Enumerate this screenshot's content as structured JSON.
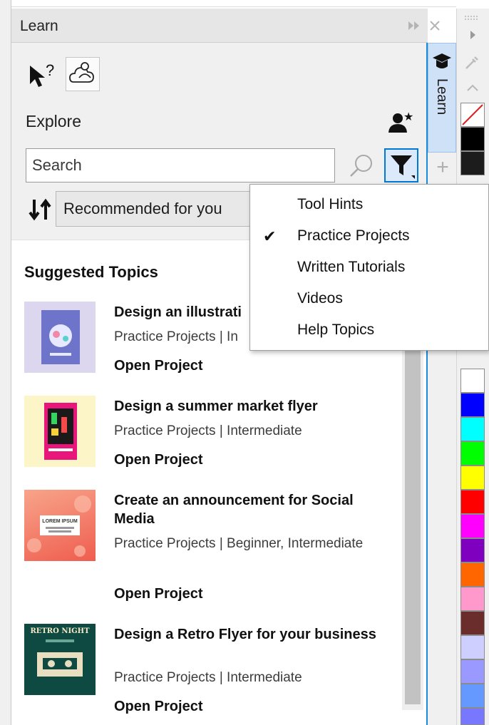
{
  "panel": {
    "title": "Learn",
    "explore_label": "Explore",
    "search": {
      "placeholder": "Search",
      "value": ""
    },
    "sort": {
      "selected": "Recommended for you"
    },
    "section_title": "Suggested Topics",
    "tab_label": "Learn",
    "cards": [
      {
        "title": "Design an illustrati",
        "meta": "Practice Projects | In",
        "action": "Open Project"
      },
      {
        "title": "Design a summer market flyer",
        "meta": "Practice Projects | Intermediate",
        "action": "Open Project"
      },
      {
        "title": "Create an announcement for Social Media",
        "meta": "Practice Projects | Beginner, Intermediate",
        "action": "Open Project"
      },
      {
        "title": "Design a Retro Flyer for your business",
        "meta": "Practice Projects | Intermediate",
        "action": "Open Project"
      }
    ],
    "thumb_text": {
      "card3_banner": "LOREM IPSUM",
      "card4_banner": "RETRO NIGHT"
    }
  },
  "filter_menu": {
    "items": [
      {
        "label": "Tool Hints",
        "checked": false
      },
      {
        "label": "Practice Projects",
        "checked": true
      },
      {
        "label": "Written Tutorials",
        "checked": false
      },
      {
        "label": "Videos",
        "checked": false
      },
      {
        "label": "Help Topics",
        "checked": false
      }
    ],
    "check_glyph": "✔"
  },
  "icons": {
    "title_collapse": "double-chevron-right-icon",
    "title_close": "close-icon",
    "plus": "+"
  },
  "colors": {
    "accent": "#0078d7",
    "tab_background": "#cfe1f7",
    "palette": [
      "#ffffff",
      "#000000",
      "#1c1c1c",
      "#ffffff",
      "#0000ff",
      "#00ffff",
      "#00ff00",
      "#ffff00",
      "#ff0000",
      "#ff00ff",
      "#8000c0",
      "#ff6600",
      "#ff99cc",
      "#6b2c2c",
      "#cfcfff",
      "#9999ff",
      "#6699ff",
      "#7777ff"
    ]
  }
}
